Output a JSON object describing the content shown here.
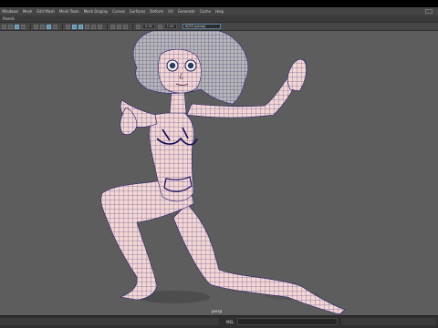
{
  "menu": {
    "items": [
      "Windows",
      "Mesh",
      "Edit Mesh",
      "Mesh Tools",
      "Mesh Display",
      "Curves",
      "Surfaces",
      "Deform",
      "UV",
      "Generate",
      "Cache",
      "Help"
    ]
  },
  "panel": {
    "label": "Panels"
  },
  "toolbar": {
    "field_a": "0.00",
    "field_b": "1.00",
    "camera": "ACES (persp)"
  },
  "viewport": {
    "camera_label": "persp"
  },
  "statusbar": {
    "mel_label": "MEL"
  },
  "colors": {
    "viewport_bg": "#5d5d5d",
    "skin": "#f3d6d3",
    "wire": "#241c6e",
    "hair": "#b9b6b8"
  }
}
